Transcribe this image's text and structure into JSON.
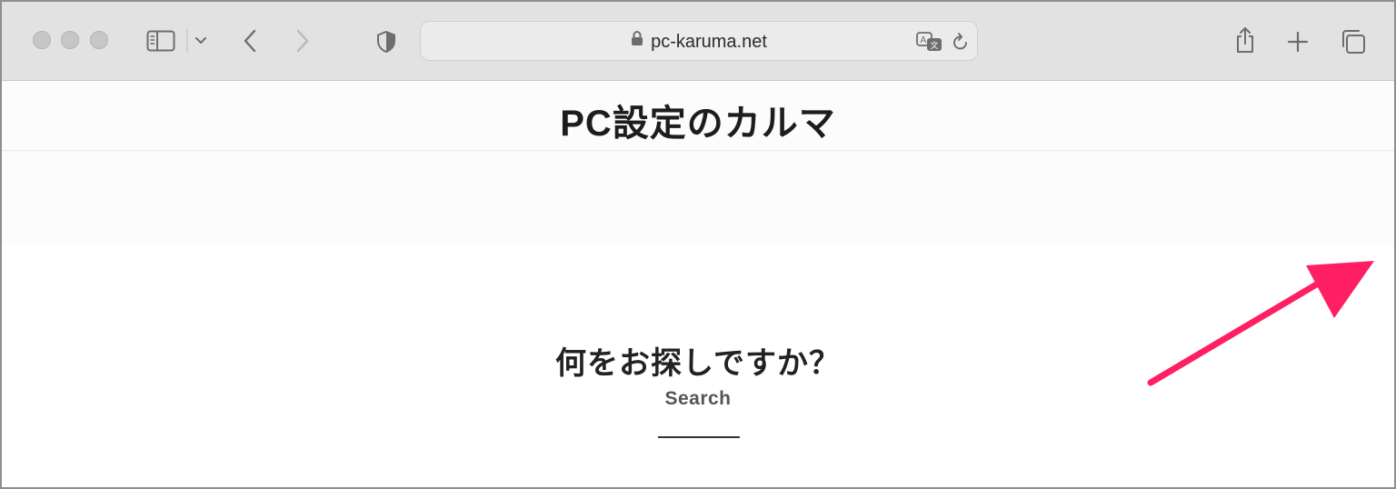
{
  "browser": {
    "url": "pc-karuma.net",
    "icons": {
      "close": "traffic-light-close-icon",
      "minimize": "traffic-light-minimize-icon",
      "zoom": "traffic-light-zoom-icon",
      "sidebar": "sidebar-icon",
      "sidebar_menu": "chevron-down-icon",
      "back": "chevron-left-icon",
      "forward": "chevron-right-icon",
      "privacy": "shield-icon",
      "lock": "lock-icon",
      "translate": "translate-icon",
      "reload": "reload-icon",
      "share": "share-icon",
      "new_tab": "plus-icon",
      "tabs": "tab-overview-icon"
    }
  },
  "page": {
    "site_title": "PC設定のカルマ",
    "search_heading": "何をお探しですか？",
    "search_sub": "Search"
  },
  "annotation": {
    "type": "arrow",
    "color": "#ff1f63"
  },
  "colors": {
    "toolbar_bg": "#e2e2e2",
    "url_bar_bg": "#ebebeb",
    "header_bg": "#fcfcfc",
    "text": "#1d1d1d"
  }
}
